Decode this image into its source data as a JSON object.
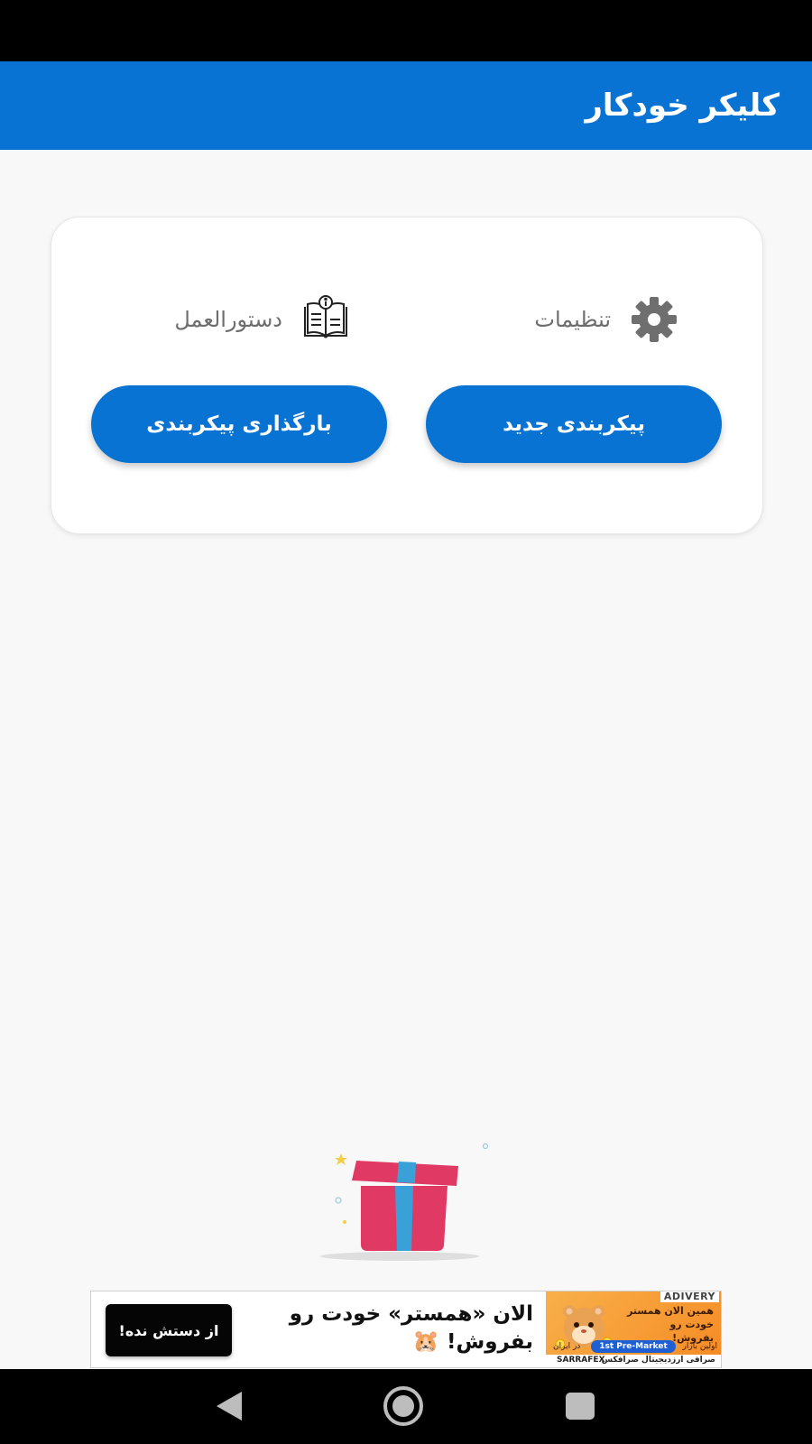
{
  "app_bar": {
    "title": "کلیکر خودکار"
  },
  "menu": {
    "settings_label": "تنظیمات",
    "settings_icon": "gear-icon",
    "manual_label": "دستورالعمل",
    "manual_icon": "book-info-icon"
  },
  "actions": {
    "new_config_label": "پیکربندی جدید",
    "load_config_label": "بارگذاری پیکربندی"
  },
  "ad": {
    "brand": "ADIVERY",
    "image_title": "همین الان همستر خودت رو بفروش!",
    "first_market": "اولین بازار",
    "pre_market": "1st  Pre-Market",
    "in_iran": "در ایران",
    "exchange": "صرافی ارزدیجیتال صرافکس",
    "logo": "SARRAFEX",
    "headline": "الان «همستر» خودت رو بفروش!",
    "headline_emoji": "🐹",
    "cta_label": "از دستش نده!"
  },
  "colors": {
    "primary": "#0873d2",
    "background": "#f8f8f8",
    "gift_red": "#e03a64",
    "gift_ribbon": "#3aa0d8"
  }
}
